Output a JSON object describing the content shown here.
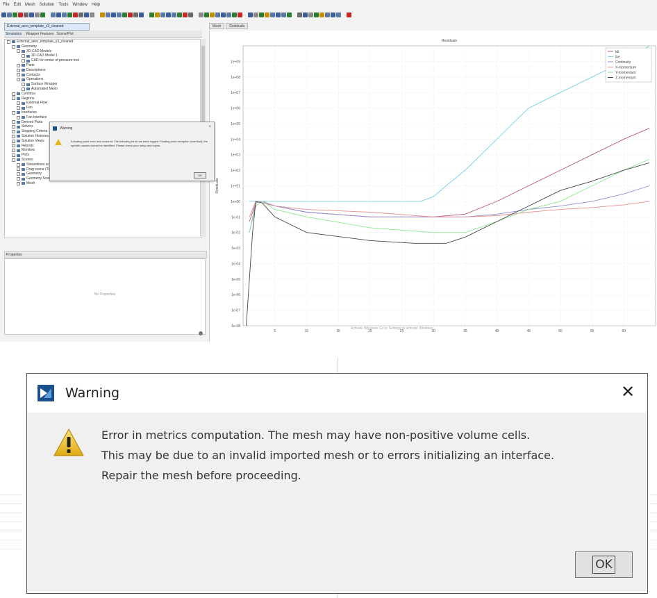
{
  "menu": [
    "File",
    "Edit",
    "Mesh",
    "Solution",
    "Tools",
    "Window",
    "Help"
  ],
  "file_tab": "External_aero_template_v3_cleaned",
  "left_tabs": [
    "Simulation",
    "Wrapper Features",
    "Scene/Plot"
  ],
  "tree_items": [
    {
      "label": "External_aero_template_v3_cleaned",
      "indent": 0
    },
    {
      "label": "Geometry",
      "indent": 1
    },
    {
      "label": "3D-CAD Models",
      "indent": 2
    },
    {
      "label": "3D-CAD Model 1",
      "indent": 3
    },
    {
      "label": "CAD for center of pressure tool",
      "indent": 3
    },
    {
      "label": "Parts",
      "indent": 2
    },
    {
      "label": "Descriptions",
      "indent": 2
    },
    {
      "label": "Contacts",
      "indent": 2
    },
    {
      "label": "Operations",
      "indent": 2
    },
    {
      "label": "Surface Wrapper",
      "indent": 3
    },
    {
      "label": "Automated Mesh",
      "indent": 3
    },
    {
      "label": "Continua",
      "indent": 1
    },
    {
      "label": "Regions",
      "indent": 1
    },
    {
      "label": "External Flow",
      "indent": 2
    },
    {
      "label": "Fan",
      "indent": 2
    },
    {
      "label": "Interfaces",
      "indent": 1
    },
    {
      "label": "Fan Interface",
      "indent": 2
    },
    {
      "label": "Derived Parts",
      "indent": 1
    },
    {
      "label": "Solvers",
      "indent": 1
    },
    {
      "label": "Stopping Criteria",
      "indent": 1
    },
    {
      "label": "Solution Histories",
      "indent": 1
    },
    {
      "label": "Solution Views",
      "indent": 1
    },
    {
      "label": "Reports",
      "indent": 1
    },
    {
      "label": "Monitors",
      "indent": 1
    },
    {
      "label": "Plots",
      "indent": 1
    },
    {
      "label": "Scenes",
      "indent": 1
    },
    {
      "label": "Streamlines scene (Track reports)",
      "indent": 2
    },
    {
      "label": "Drag scene (Track reports)",
      "indent": 2
    },
    {
      "label": "Geometry",
      "indent": 2
    },
    {
      "label": "Geometry Scene 1",
      "indent": 2
    },
    {
      "label": "Mesh",
      "indent": 2
    }
  ],
  "properties_title": "Properties",
  "no_properties": "No Properties",
  "plot_tabs": [
    "Mesh",
    "Residuals"
  ],
  "colors": {
    "logo": "#1b4f8a",
    "warning": "#e7b81c",
    "tke": "#6fd0e8",
    "tdr": "#b9576f",
    "continuity": "#8f8fd0",
    "xmom": "#e58f8f",
    "ymom": "#8fe58f",
    "zmom": "#444444"
  },
  "chart_data": {
    "type": "line",
    "title": "Residuals",
    "xlabel": "",
    "ylabel": "Residuals",
    "yscale": "log",
    "ylim": [
      1e-08,
      10000000000.0
    ],
    "xlim": [
      0,
      65
    ],
    "xticks": [
      5,
      10,
      15,
      20,
      25,
      30,
      35,
      40,
      45,
      50,
      55,
      60
    ],
    "yticks": [
      "1e-08",
      "1e-07",
      "1e-06",
      "1e-05",
      "1e-04",
      "1e-03",
      "1e-02",
      "1e-01",
      "1e+00",
      "1e+01",
      "1e+02",
      "1e+03",
      "1e+04",
      "1e+05",
      "1e+06",
      "1e+07",
      "1e+08",
      "1e+09"
    ],
    "grid": true,
    "legend_position": "top-right",
    "series": [
      {
        "name": "tdr",
        "color": "#b9576f",
        "x": [
          1,
          2,
          3,
          5,
          10,
          20,
          30,
          35,
          40,
          45,
          50,
          55,
          60,
          64
        ],
        "y": [
          0.05,
          0.8,
          1,
          0.5,
          0.2,
          0.1,
          0.1,
          0.15,
          1,
          10,
          100,
          1000,
          10000,
          50000
        ]
      },
      {
        "name": "tke",
        "color": "#6fd0e8",
        "x": [
          1,
          2,
          3,
          5,
          10,
          20,
          28,
          30,
          32,
          35,
          40,
          45,
          50,
          55,
          60,
          64
        ],
        "y": [
          1,
          1,
          1,
          1,
          1,
          1,
          1,
          2,
          10,
          100,
          10000.0,
          1000000.0,
          10000000.0,
          100000000.0,
          1000000000.0,
          10000000000.0
        ]
      },
      {
        "name": "Continuity",
        "color": "#8f8fd0",
        "x": [
          1,
          2,
          3,
          5,
          10,
          20,
          30,
          35,
          40,
          45,
          50,
          55,
          60,
          64
        ],
        "y": [
          0.01,
          0.8,
          1,
          0.5,
          0.2,
          0.1,
          0.1,
          0.1,
          0.15,
          0.3,
          0.5,
          1,
          3,
          10
        ]
      },
      {
        "name": "X-momentum",
        "color": "#e58f8f",
        "x": [
          1,
          2,
          3,
          5,
          10,
          20,
          30,
          35,
          40,
          45,
          50,
          55,
          60,
          64
        ],
        "y": [
          0.1,
          1,
          0.8,
          0.5,
          0.3,
          0.2,
          0.1,
          0.1,
          0.12,
          0.2,
          0.3,
          0.4,
          0.6,
          1
        ]
      },
      {
        "name": "Y-momentum",
        "color": "#8fe58f",
        "x": [
          1,
          2,
          3,
          5,
          10,
          20,
          30,
          35,
          40,
          45,
          50,
          55,
          60,
          64
        ],
        "y": [
          0.01,
          0.5,
          1,
          0.3,
          0.1,
          0.02,
          0.01,
          0.01,
          0.05,
          0.3,
          1,
          10,
          100,
          500
        ]
      },
      {
        "name": "Z-momentum",
        "color": "#444444",
        "x": [
          0.5,
          1,
          1.5,
          2,
          3,
          5,
          10,
          20,
          27,
          32,
          35,
          40,
          45,
          50,
          55,
          60,
          64
        ],
        "y": [
          1e-08,
          1e-05,
          0.01,
          1,
          0.8,
          0.1,
          0.01,
          0.003,
          0.002,
          0.002,
          0.005,
          0.05,
          0.5,
          5,
          20,
          100,
          300
        ]
      }
    ]
  },
  "small_dialog": {
    "title": "Warning",
    "message": "A floating point error has occurred. The following error has been logged: Floating point exception (overflow); the specific causes cannot be identified. Please check your setup and inputs.",
    "ok": "OK"
  },
  "watermark": "Activate Windows Go to Settings to activate Windows.",
  "dialog": {
    "title": "Warning",
    "close": "✕",
    "lines": [
      "Error in metrics computation. The mesh may have non-positive volume cells.",
      "This may be due to an invalid imported mesh or to errors initializing an interface.",
      "Repair the mesh before proceeding."
    ],
    "ok": "OK"
  }
}
